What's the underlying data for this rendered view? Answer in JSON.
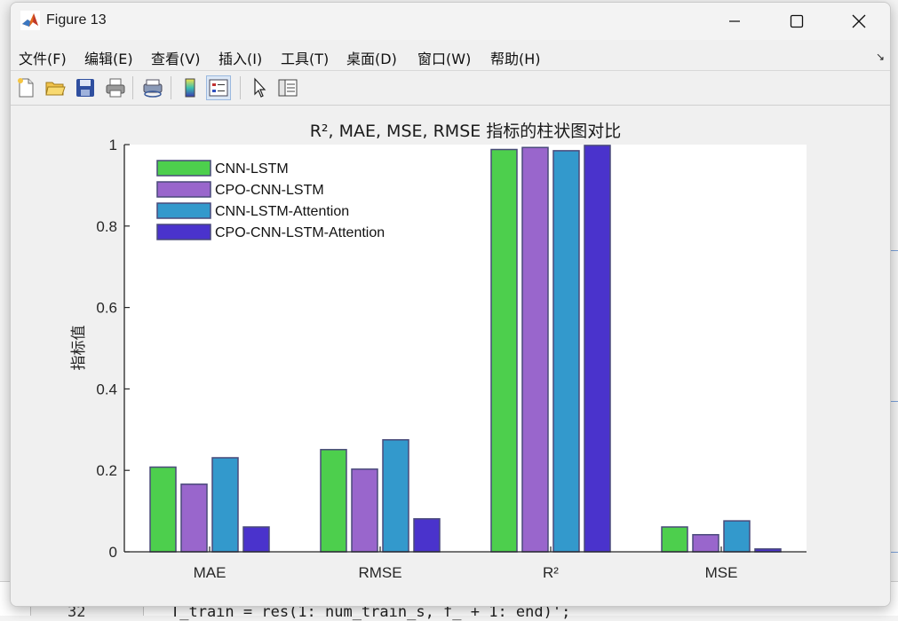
{
  "window": {
    "title": "Figure 13"
  },
  "menu": {
    "items": [
      "文件(F)",
      "编辑(E)",
      "查看(V)",
      "插入(I)",
      "工具(T)",
      "桌面(D)",
      "窗口(W)",
      "帮助(H)"
    ]
  },
  "toolbar": {
    "buttons": [
      {
        "icon": "new-figure-icon"
      },
      {
        "icon": "open-file-icon"
      },
      {
        "icon": "save-icon"
      },
      {
        "icon": "print-icon"
      },
      {
        "icon": "print-preview-icon"
      },
      {
        "icon": "colorbar-icon"
      },
      {
        "icon": "legend-icon",
        "active": true
      },
      {
        "icon": "pointer-icon"
      },
      {
        "icon": "property-editor-icon"
      }
    ]
  },
  "editor": {
    "line_number": "32",
    "code_line": "T_train = res(1: num_train_s, f_ + 1: end)';"
  },
  "chart_data": {
    "type": "bar",
    "title": "R², MAE, MSE, RMSE 指标的柱状图对比",
    "xlabel": "",
    "ylabel": "指标值",
    "categories": [
      "MAE",
      "RMSE",
      "R²",
      "MSE"
    ],
    "ylim": [
      0,
      1
    ],
    "yticks": [
      0,
      0.2,
      0.4,
      0.6,
      0.8,
      1
    ],
    "ytick_labels": [
      "0",
      "0.2",
      "0.4",
      "0.6",
      "0.8",
      "1"
    ],
    "grid": false,
    "legend_position": "top-left",
    "series": [
      {
        "name": "CNN-LSTM",
        "color": "#4dcf4d",
        "values": [
          0.208,
          0.251,
          0.988,
          0.061
        ]
      },
      {
        "name": "CPO-CNN-LSTM",
        "color": "#9966cc",
        "values": [
          0.166,
          0.203,
          0.993,
          0.042
        ]
      },
      {
        "name": "CNN-LSTM-Attention",
        "color": "#3399cc",
        "values": [
          0.231,
          0.275,
          0.985,
          0.076
        ]
      },
      {
        "name": "CPO-CNN-LSTM-Attention",
        "color": "#4a33cc",
        "values": [
          0.061,
          0.081,
          0.998,
          0.007
        ]
      }
    ],
    "bar_edge_color": "#4a4a7a"
  }
}
